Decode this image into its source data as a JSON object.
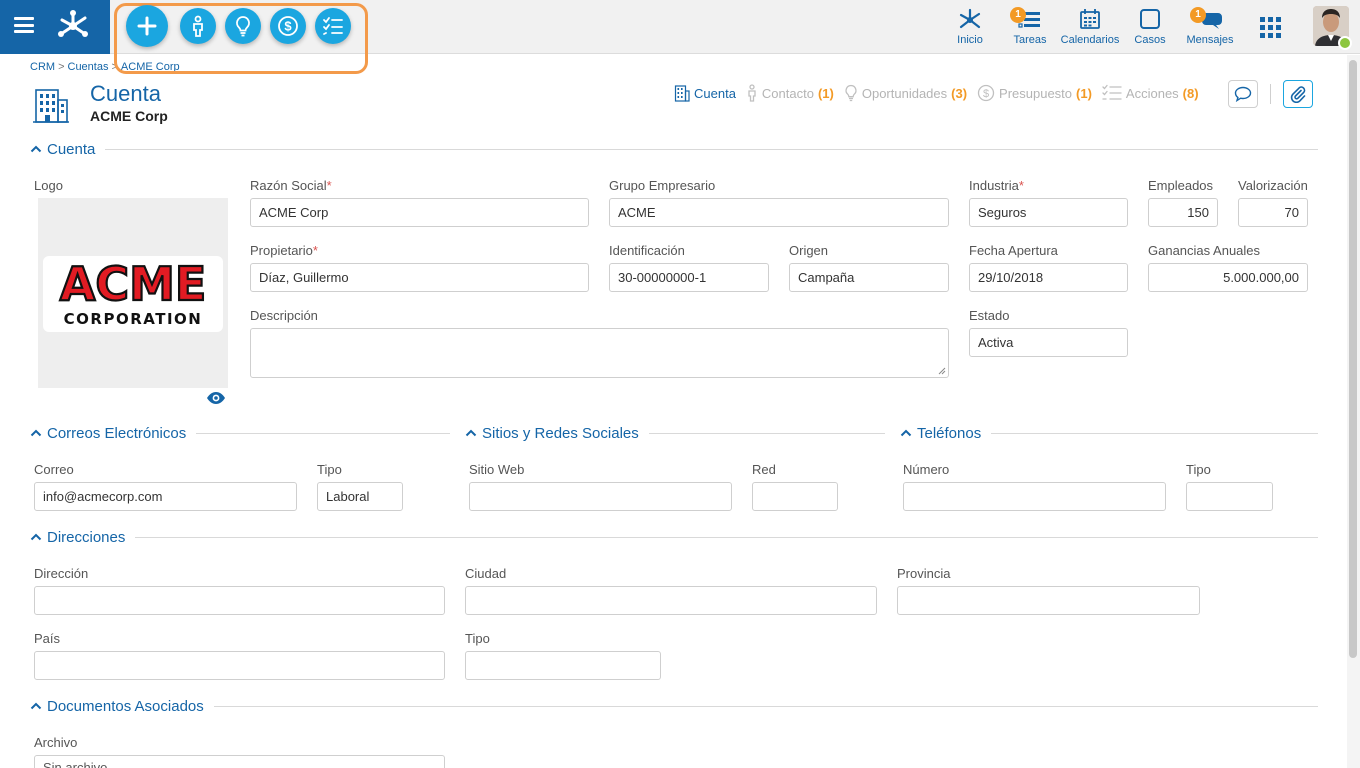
{
  "topbar": {
    "nav": [
      {
        "label": "Inicio",
        "icon": "network-home-icon"
      },
      {
        "label": "Tareas",
        "icon": "tasks-icon",
        "badge": "1"
      },
      {
        "label": "Calendarios",
        "icon": "calendar-icon"
      },
      {
        "label": "Casos",
        "icon": "cases-icon"
      },
      {
        "label": "Mensajes",
        "icon": "chat-bubbles-icon",
        "badge": "1"
      }
    ],
    "quick_actions": [
      "add-icon",
      "contact-person-icon",
      "lightbulb-icon",
      "dollar-icon",
      "checklist-icon"
    ],
    "accent_color": "#1565a7",
    "highlight_color": "#f39a4a"
  },
  "breadcrumb": {
    "items": [
      "CRM",
      "Cuentas",
      "ACME Corp"
    ],
    "separator": ">"
  },
  "header": {
    "title": "Cuenta",
    "subtitle": "ACME Corp",
    "tabs": [
      {
        "label": "Cuenta",
        "count": ""
      },
      {
        "label": "Contacto",
        "count": "(1)"
      },
      {
        "label": "Oportunidades",
        "count": "(3)"
      },
      {
        "label": "Presupuesto",
        "count": "(1)"
      },
      {
        "label": "Acciones",
        "count": "(8)"
      }
    ]
  },
  "sections": {
    "cuenta": "Cuenta",
    "correos": "Correos Electrónicos",
    "sitios": "Sitios y Redes Sociales",
    "telefonos": "Teléfonos",
    "direcciones": "Direcciones",
    "documentos": "Documentos Asociados"
  },
  "cuenta": {
    "logo_label": "Logo",
    "logo_text_top": "ACME",
    "logo_text_bottom": "CORPORATION",
    "razon_social_label": "Razón Social",
    "razon_social": "ACME Corp",
    "grupo_label": "Grupo Empresario",
    "grupo": "ACME",
    "industria_label": "Industria",
    "industria": "Seguros",
    "empleados_label": "Empleados",
    "empleados": "150",
    "valorizacion_label": "Valorización",
    "valorizacion": "70",
    "propietario_label": "Propietario",
    "propietario": "Díaz, Guillermo",
    "identificacion_label": "Identificación",
    "identificacion": "30-00000000-1",
    "origen_label": "Origen",
    "origen": "Campaña",
    "fecha_label": "Fecha Apertura",
    "fecha": "29/10/2018",
    "ganancias_label": "Ganancias Anuales",
    "ganancias": "5.000.000,00",
    "descripcion_label": "Descripción",
    "descripcion": "",
    "estado_label": "Estado",
    "estado": "Activa",
    "required_mark": "*"
  },
  "correos": {
    "correo_label": "Correo",
    "correo": "info@acmecorp.com",
    "tipo_label": "Tipo",
    "tipo": "Laboral"
  },
  "sitios": {
    "sitio_label": "Sitio Web",
    "sitio": "",
    "red_label": "Red",
    "red": ""
  },
  "telefonos": {
    "numero_label": "Número",
    "numero": "",
    "tipo_label": "Tipo",
    "tipo": ""
  },
  "direcciones": {
    "direccion_label": "Dirección",
    "ciudad_label": "Ciudad",
    "provincia_label": "Provincia",
    "pais_label": "País",
    "tipo_label": "Tipo"
  },
  "documentos": {
    "archivo_label": "Archivo",
    "archivo": "Sin archivo"
  }
}
